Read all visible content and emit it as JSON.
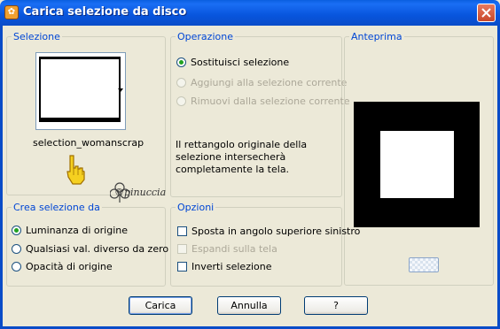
{
  "window": {
    "title": "Carica selezione da disco"
  },
  "selezione": {
    "label": "Selezione",
    "filename": "selection_womanscrap",
    "watermark": "©pinuccia"
  },
  "operazione": {
    "label": "Operazione",
    "options": [
      {
        "label": "Sostituisci selezione",
        "checked": true,
        "enabled": true
      },
      {
        "label": "Aggiungi alla selezione corrente",
        "checked": false,
        "enabled": false
      },
      {
        "label": "Rimuovi dalla selezione corrente",
        "checked": false,
        "enabled": false
      }
    ],
    "message": "Il rettangolo originale della selezione intersecherà completamente la tela."
  },
  "anteprima": {
    "label": "Anteprima"
  },
  "crea": {
    "label": "Crea selezione da",
    "options": [
      {
        "label": "Luminanza di origine",
        "checked": true
      },
      {
        "label": "Qualsiasi val. diverso da zero",
        "checked": false
      },
      {
        "label": "Opacità di origine",
        "checked": false
      }
    ]
  },
  "opzioni": {
    "label": "Opzioni",
    "items": [
      {
        "label": "Sposta in angolo superiore sinistro",
        "checked": false,
        "enabled": true
      },
      {
        "label": "Espandi sulla tela",
        "checked": false,
        "enabled": false
      },
      {
        "label": "Inverti selezione",
        "checked": false,
        "enabled": true
      }
    ]
  },
  "buttons": {
    "ok": "Carica",
    "cancel": "Annulla",
    "help": "?"
  },
  "colors": {
    "titlebar": "#0a5fe0",
    "group_label": "#0046d5",
    "radio_dot": "#21a121",
    "window_bg": "#ece9d8"
  }
}
